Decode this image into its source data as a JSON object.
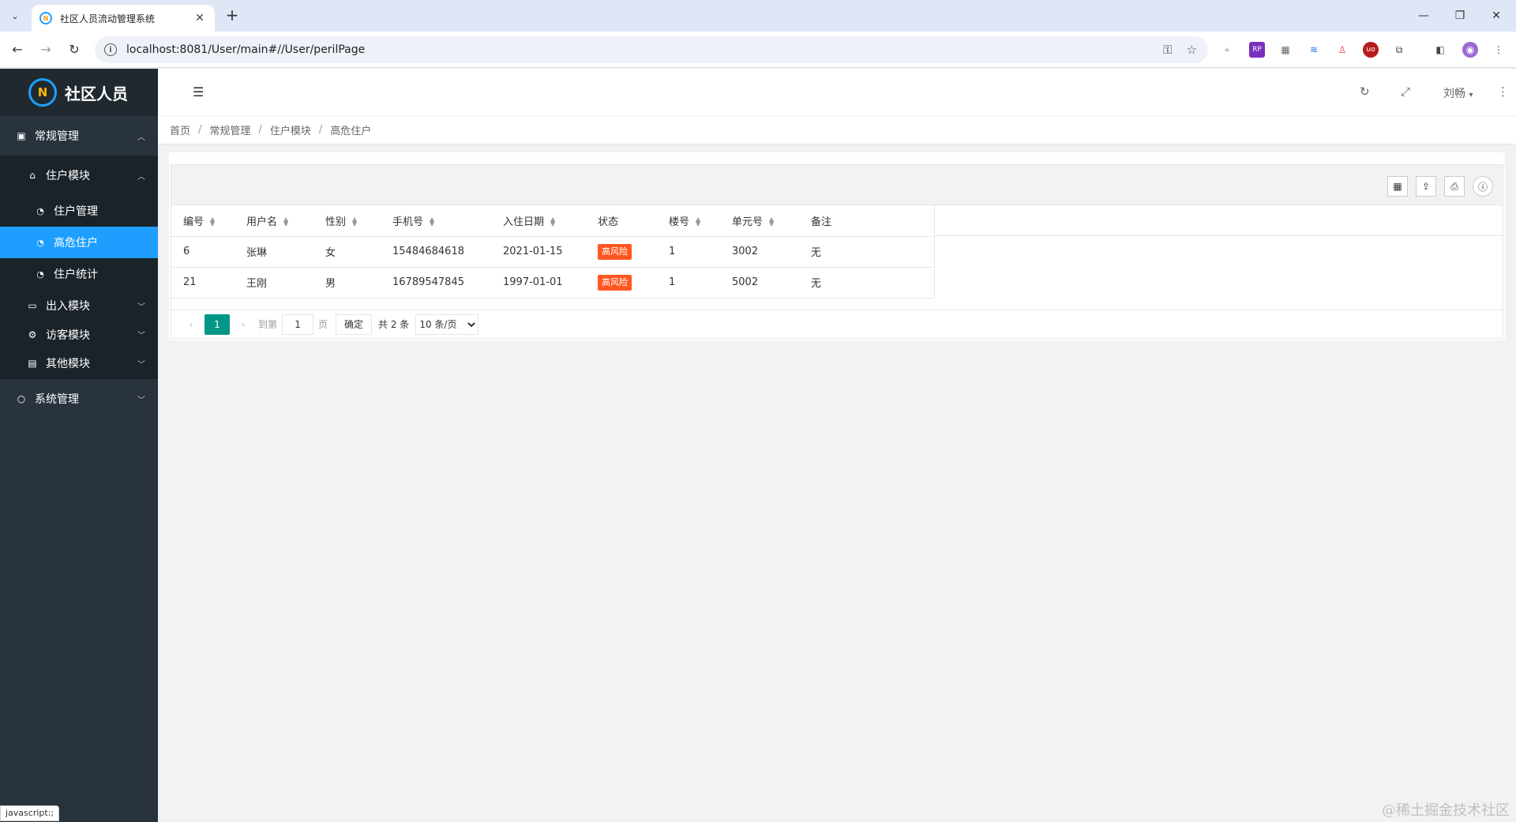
{
  "browser": {
    "tab_title": "社区人员流动管理系统",
    "tab_close": "✕",
    "new_tab": "+",
    "url": "localhost:8081/User/main#//User/perilPage",
    "win_min": "—",
    "win_restore": "❐",
    "win_close": "✕"
  },
  "sidebar": {
    "logo_text": "社区人员",
    "groups": [
      {
        "label": "常规管理"
      },
      {
        "label": "住户模块"
      },
      {
        "label": "出入模块"
      },
      {
        "label": "访客模块"
      },
      {
        "label": "其他模块"
      },
      {
        "label": "系统管理"
      }
    ],
    "leaves": [
      {
        "label": "住户管理"
      },
      {
        "label": "高危住户"
      },
      {
        "label": "住户统计"
      }
    ],
    "status_hint": "javascript:;"
  },
  "header": {
    "user": "刘畅"
  },
  "breadcrumb": {
    "items": [
      "首页",
      "常规管理",
      "住户模块",
      "高危住户"
    ],
    "sep": "/"
  },
  "table": {
    "columns": [
      "编号",
      "用户名",
      "性别",
      "手机号",
      "入住日期",
      "状态",
      "楼号",
      "单元号",
      "备注"
    ],
    "rows": [
      {
        "id": "6",
        "name": "张琳",
        "gender": "女",
        "phone": "15484684618",
        "date": "2021-01-15",
        "status": "高风险",
        "building": "1",
        "unit": "3002",
        "note": "无"
      },
      {
        "id": "21",
        "name": "王刚",
        "gender": "男",
        "phone": "16789547845",
        "date": "1997-01-01",
        "status": "高风险",
        "building": "1",
        "unit": "5002",
        "note": "无"
      }
    ]
  },
  "pager": {
    "current": "1",
    "goto_label": "到第",
    "goto_value": "1",
    "page_label": "页",
    "confirm": "确定",
    "total": "共 2 条",
    "page_size": "10 条/页"
  },
  "watermark": "@稀土掘金技术社区",
  "colors": {
    "sidebar_bg": "#28333e",
    "active_item": "#1e9fff",
    "status_badge": "#ff5722",
    "pager_active": "#009688"
  }
}
